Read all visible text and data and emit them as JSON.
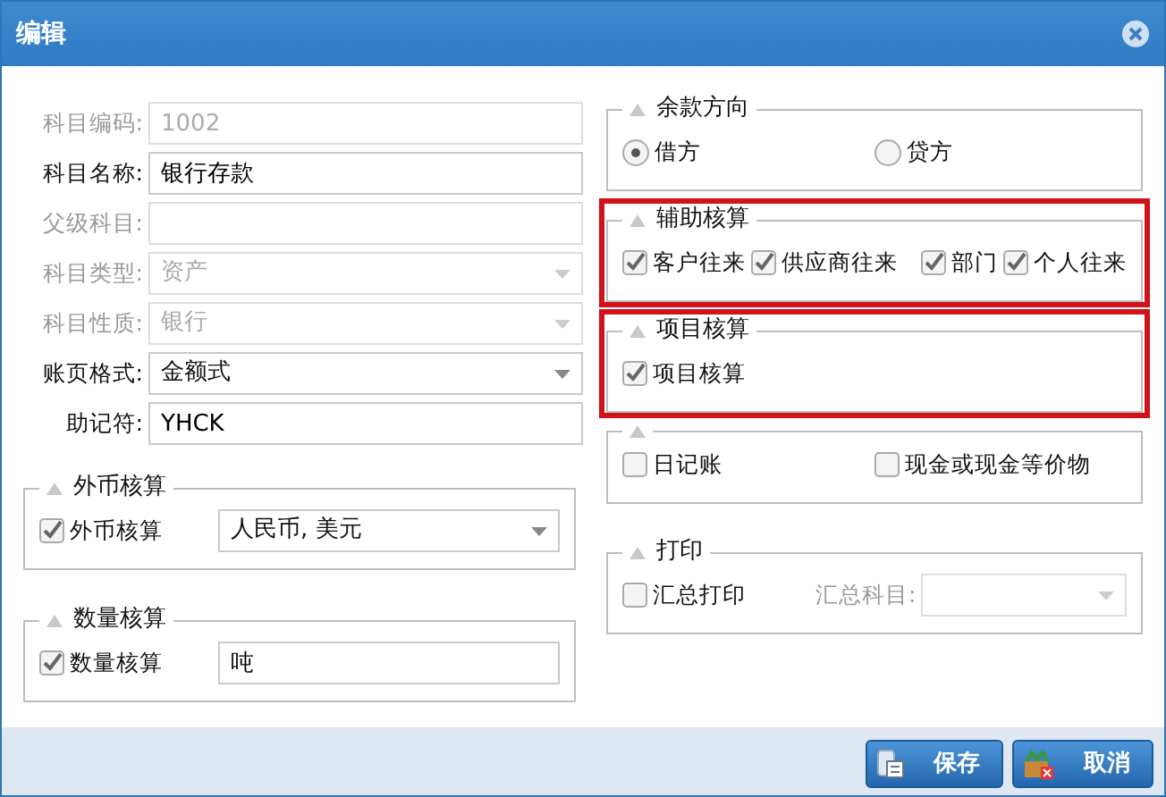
{
  "window": {
    "title": "编辑"
  },
  "fields": [
    {
      "label": "科目编码:",
      "value": "1002",
      "kind": "text",
      "disabled": true
    },
    {
      "label": "科目名称:",
      "value": "银行存款",
      "kind": "text",
      "disabled": false
    },
    {
      "label": "父级科目:",
      "kind": "text",
      "disabled": true
    },
    {
      "label": "科目类型:",
      "value": "资产",
      "kind": "select",
      "disabled": true
    },
    {
      "label": "科目性质:",
      "value": "银行",
      "kind": "select",
      "disabled": true
    },
    {
      "label": "账页格式:",
      "value": "金额式",
      "kind": "select",
      "disabled": false
    },
    {
      "label": "助记符:",
      "value": "YHCK",
      "kind": "text",
      "disabled": false
    }
  ],
  "left_groups": [
    {
      "title": "外币核算",
      "highlighted": false,
      "items": [
        {
          "kind": "checkbox",
          "label": "外币核算",
          "checked": true
        },
        {
          "kind": "select",
          "value": "人民币, 美元",
          "disabled": false
        }
      ]
    },
    {
      "title": "数量核算",
      "highlighted": false,
      "items": [
        {
          "kind": "checkbox",
          "label": "数量核算",
          "checked": true
        },
        {
          "kind": "text",
          "value": "吨",
          "disabled": false
        }
      ]
    }
  ],
  "right_groups": [
    {
      "title": "余款方向",
      "highlighted": false,
      "items": [
        {
          "kind": "radio",
          "label": "借方",
          "selected": true
        },
        {
          "kind": "radio",
          "label": "贷方",
          "selected": false
        }
      ]
    },
    {
      "title": "辅助核算",
      "highlighted": true,
      "items": [
        {
          "kind": "checkbox",
          "label": "客户往来",
          "checked": true
        },
        {
          "kind": "checkbox",
          "label": "供应商往来",
          "checked": true
        },
        {
          "kind": "checkbox",
          "label": "部门",
          "checked": true
        },
        {
          "kind": "checkbox",
          "label": "个人往来",
          "checked": true
        }
      ]
    },
    {
      "title": "项目核算",
      "highlighted": true,
      "items": [
        {
          "kind": "checkbox",
          "label": "项目核算",
          "checked": true
        }
      ]
    },
    {
      "highlighted": false,
      "items": [
        {
          "kind": "checkbox",
          "label": "日记账",
          "checked": false
        },
        {
          "kind": "checkbox",
          "label": "现金或现金等价物",
          "checked": false
        }
      ]
    },
    {
      "title": "打印",
      "highlighted": false,
      "items": [
        {
          "kind": "checkbox",
          "label": "汇总打印",
          "checked": false
        },
        {
          "kind": "label",
          "text": "汇总科目:",
          "disabled": true
        },
        {
          "kind": "select",
          "disabled": true
        }
      ]
    }
  ],
  "buttons": [
    {
      "label": "保存",
      "kind": "save"
    },
    {
      "label": "取消",
      "kind": "cancel"
    }
  ]
}
